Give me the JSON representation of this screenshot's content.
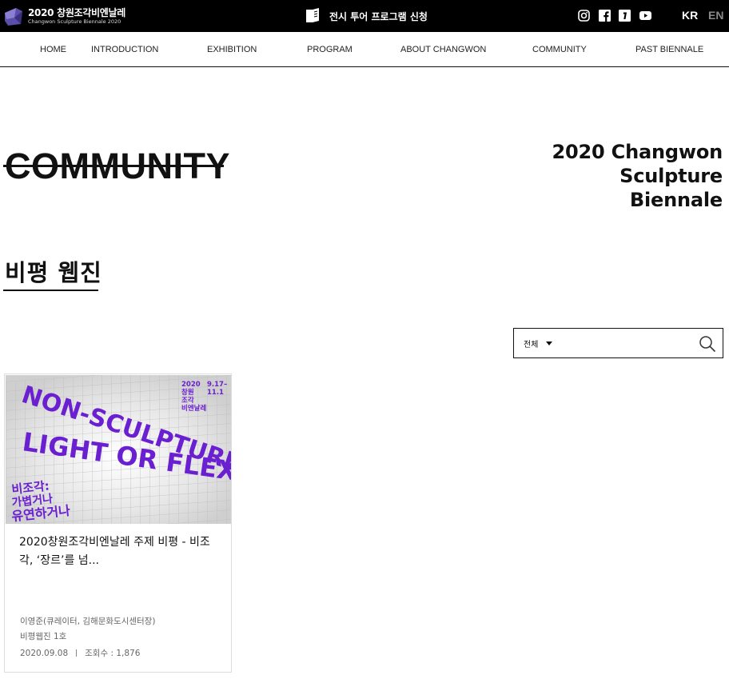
{
  "header": {
    "logo_title": "2020 창원조각비엔날레",
    "logo_subtitle": "Changwon Sculpture Biennale 2020",
    "tour_label": "전시 투어 프로그램 신청",
    "social": [
      "instagram-icon",
      "facebook-icon",
      "blog-icon",
      "youtube-icon"
    ],
    "lang_kr": "KR",
    "lang_en": "EN"
  },
  "nav": {
    "items": [
      "HOME",
      "INTRODUCTION",
      "EXHIBITION",
      "PROGRAM",
      "ABOUT CHANGWON",
      "COMMUNITY",
      "PAST BIENNALE"
    ]
  },
  "page": {
    "title": "COMMUNITY",
    "side_title_lines": [
      "2020 Changwon",
      "Sculpture",
      "Biennale"
    ],
    "section_title": "비평 웹진"
  },
  "search": {
    "select_value": "전체",
    "placeholder": ""
  },
  "card": {
    "poster": {
      "headline_1": "NON-SCULPTURE:",
      "headline_2": "LIGHT OR FLEXIBLE",
      "korean_1": "비조각:",
      "korean_2": "가볍거나",
      "korean_3": "유연하거나",
      "brand_1": "2020",
      "brand_2": "창원",
      "brand_3": "조각",
      "brand_4": "비엔날레",
      "date_1": "9.17–",
      "date_2": "11.1"
    },
    "title": "2020창원조각비엔날레 주제 비평 - 비조각, ‘장르’를 넘...",
    "author": "이영준(큐레이터, 김해문화도시센터장)",
    "issue": "비평웹진 1호",
    "date": "2020.09.08",
    "views": "조회수 : 1,876"
  },
  "colors": {
    "topbar": "#000000",
    "accent_purple": "#6a1fd1",
    "lang_inactive": "#8a8a8a"
  }
}
